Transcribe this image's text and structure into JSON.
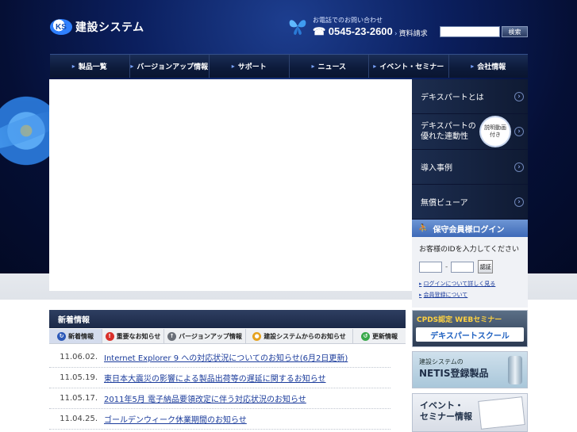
{
  "header": {
    "logo_mark": "KS",
    "logo_text": "建設システム",
    "contact_caption": "お電話でのお問い合わせ",
    "contact_phone": "☎ 0545-23-2600",
    "doc_request": "資料請求",
    "search_placeholder": "",
    "search_button": "検索"
  },
  "nav": {
    "items": [
      {
        "label": "製品一覧"
      },
      {
        "label": "バージョンアップ情報"
      },
      {
        "label": "サポート"
      },
      {
        "label": "ニュース"
      },
      {
        "label": "イベント・セミナー"
      },
      {
        "label": "会社情報"
      }
    ]
  },
  "side": {
    "items": [
      {
        "label": "デキスパートとは"
      },
      {
        "label_line1": "デキスパートの",
        "label_line2": "優れた連動性",
        "badge_line1": "説明動画",
        "badge_line2": "付き"
      },
      {
        "label": "導入事例"
      },
      {
        "label": "無償ビューア"
      }
    ],
    "login": {
      "title": "保守会員様ログイン",
      "prompt": "お客様のIDを入力してください",
      "separator": "-",
      "button": "認証",
      "links": [
        "ログインについて詳しく見る",
        "会員登録について"
      ]
    }
  },
  "news": {
    "header": "新着情報",
    "tabs": [
      {
        "label": "新着情報",
        "icon_color": "#2b58b8",
        "icon": "↻"
      },
      {
        "label": "重要なお知らせ",
        "icon_color": "#d9302a",
        "icon": "!"
      },
      {
        "label": "バージョンアップ情報",
        "icon_color": "#6a6f78",
        "icon": "↑"
      },
      {
        "label": "建設システムからのお知らせ",
        "icon_color": "#e6a21e",
        "icon": "●"
      },
      {
        "label": "更新情報",
        "icon_color": "#38a84a",
        "icon": "↺"
      }
    ],
    "items": [
      {
        "date": "11.06.02.",
        "title": "Internet Explorer 9 への対応状況についてのお知らせ(6月2日更新)"
      },
      {
        "date": "11.05.19.",
        "title": "東日本大震災の影響による製品出荷等の遅延に関するお知らせ"
      },
      {
        "date": "11.05.17.",
        "title": "2011年5月 電子納品要領改定に伴う対応状況のお知らせ"
      },
      {
        "date": "11.04.25.",
        "title": "ゴールデンウィーク休業期間のお知らせ"
      }
    ]
  },
  "banners": {
    "cpds_line1": "CPDS認定 WEBセミナー",
    "cpds_line2": "デキスパートスクール",
    "netis_line1": "建設システムの",
    "netis_line2": "NETIS登録製品",
    "event_line1": "イベント・",
    "event_line2": "セミナー情報"
  }
}
